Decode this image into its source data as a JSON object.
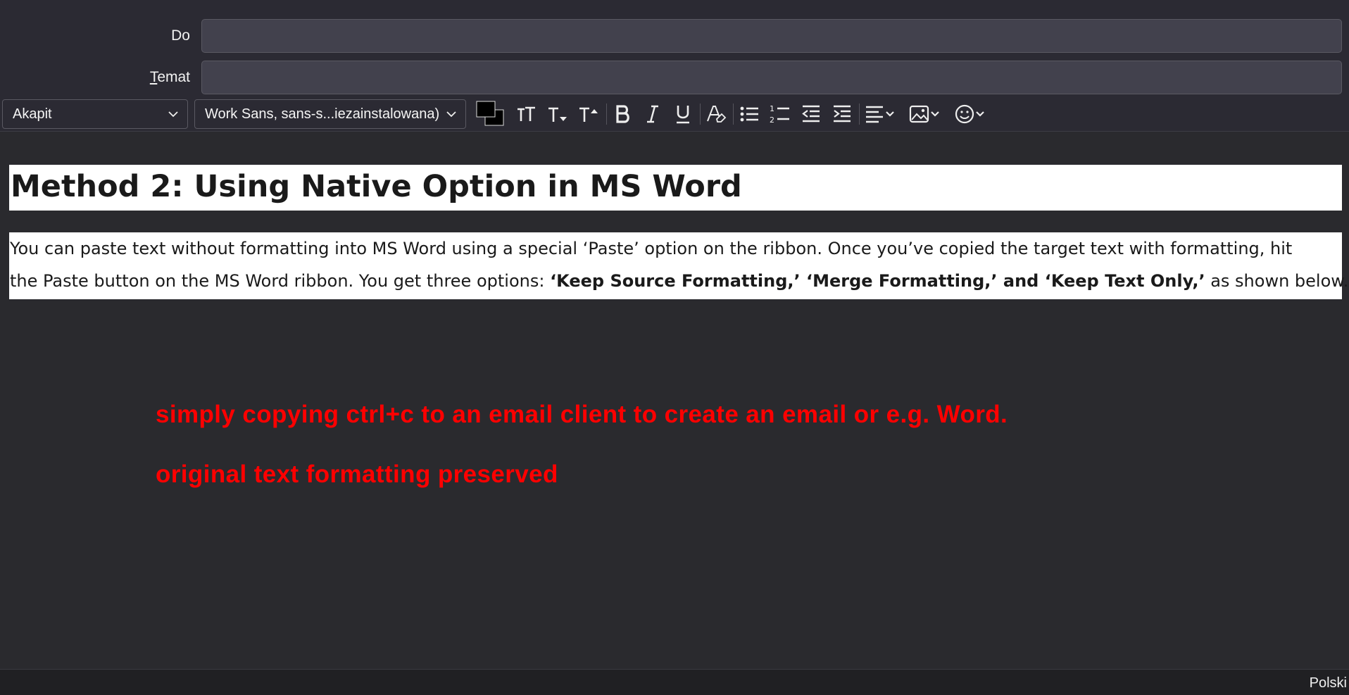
{
  "header": {
    "to_label_prefix": "Do",
    "subject_label_accel": "T",
    "subject_label_rest": "emat",
    "to_value": "",
    "subject_value": ""
  },
  "toolbar": {
    "paragraph_style": "Akapit",
    "font_family": "Work Sans, sans-s...iezainstalowana)",
    "text_color": "#000000",
    "bg_color": "#000000",
    "icons": [
      "font-size-icon",
      "decrease-font-size-icon",
      "increase-font-size-icon",
      "bold-icon",
      "italic-icon",
      "underline-icon",
      "clear-formatting-icon",
      "bulleted-list-icon",
      "numbered-list-icon",
      "decrease-indent-icon",
      "increase-indent-icon",
      "align-icon",
      "insert-image-icon",
      "emoji-icon"
    ]
  },
  "editor": {
    "heading": "Method 2: Using Native Option in MS Word",
    "paragraph_line1": "You can paste text without formatting into MS Word using a special ‘Paste’ option on the ribbon. Once you’ve copied the target text with formatting, hit",
    "paragraph_line2_start": "the Paste button on the MS Word ribbon. You get three options: ",
    "paragraph_line2_bold": "‘Keep Source Formatting,’ ‘Merge Formatting,’ and ‘Keep Text Only,’",
    "paragraph_line2_end": " as shown below.",
    "note_line1": "simply copying ctrl+c to an email client to create an email or e.g. Word.",
    "note_line2": "original text formatting preserved",
    "note_color": "#ff0000"
  },
  "status": {
    "language": "Polski"
  }
}
